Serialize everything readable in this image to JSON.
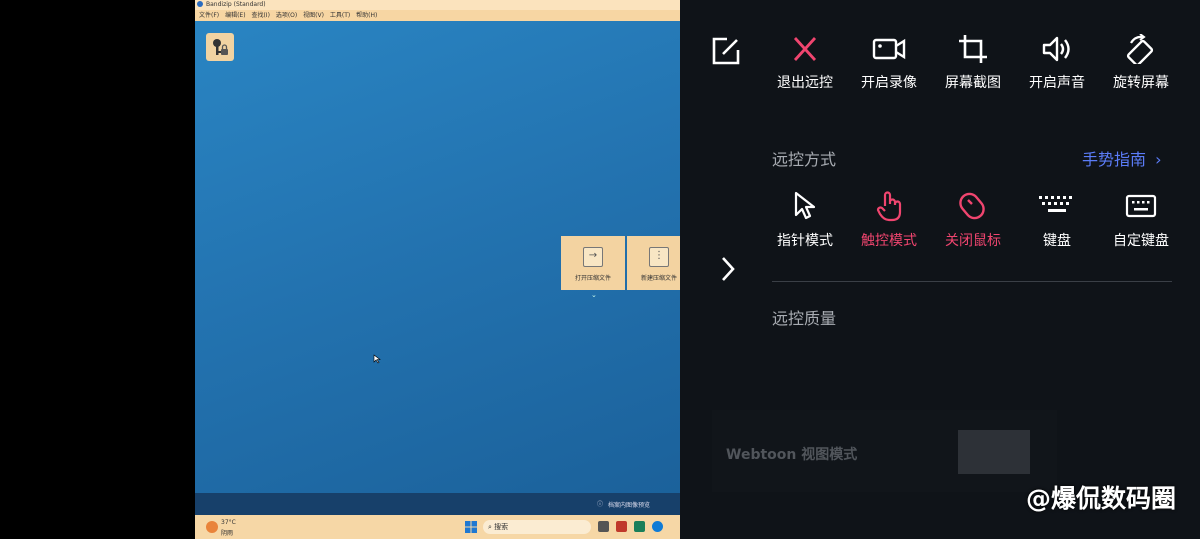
{
  "window": {
    "title": "Bandizip (Standard)",
    "menu": [
      "文件(F)",
      "编辑(E)",
      "查找(I)",
      "选项(O)",
      "视图(V)",
      "工具(T)",
      "帮助(H)"
    ]
  },
  "desktop": {
    "tiles": [
      {
        "label": "打开压缩文件",
        "icon": "open-archive-icon"
      },
      {
        "label": "新建压缩文件",
        "icon": "new-archive-icon"
      }
    ],
    "status_text": "档案内图像预览",
    "taskbar": {
      "weather_temp": "37°C",
      "weather_desc": "阴雨",
      "search_placeholder": "搜索"
    }
  },
  "remote_panel": {
    "top_actions": [
      {
        "label": "退出远控",
        "icon": "close-icon",
        "color": "#f0456f"
      },
      {
        "label": "开启录像",
        "icon": "video-icon"
      },
      {
        "label": "屏幕截图",
        "icon": "crop-icon"
      },
      {
        "label": "开启声音",
        "icon": "speaker-icon"
      },
      {
        "label": "旋转屏幕",
        "icon": "rotate-icon"
      }
    ],
    "edit_icon": "edit-icon",
    "mode_section": {
      "title": "远控方式",
      "guide_label": "手势指南",
      "modes": [
        {
          "label": "指针模式",
          "icon": "pointer-icon",
          "active": false
        },
        {
          "label": "触控模式",
          "icon": "touch-icon",
          "active": true
        },
        {
          "label": "关闭鼠标",
          "icon": "mouse-icon",
          "active": true
        },
        {
          "label": "键盘",
          "icon": "keyboard-icon",
          "active": false
        },
        {
          "label": "自定键盘",
          "icon": "custom-keyboard-icon",
          "active": false
        }
      ]
    },
    "quality_section": {
      "title": "远控质量"
    },
    "webtoon_card": {
      "title": "Webtoon 视图模式"
    }
  },
  "watermark": "@爆侃数码圈",
  "colors": {
    "accent_red": "#f0456f",
    "accent_blue": "#5b7cf7",
    "panel_bg": "#0f1318",
    "desktop_blue": "#2373b0"
  }
}
